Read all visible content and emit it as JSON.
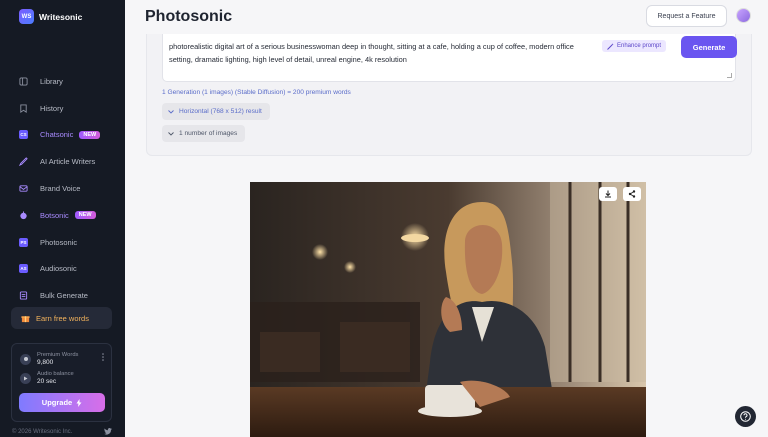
{
  "brand": {
    "name": "Writesonic",
    "logo_text": "WS"
  },
  "sidebar": {
    "items": [
      {
        "label": "Library",
        "icon": "library-icon"
      },
      {
        "label": "History",
        "icon": "bookmark-icon"
      },
      {
        "label": "Chatsonic",
        "icon": "chatsonic-icon",
        "badge": "NEW",
        "active": true
      },
      {
        "label": "AI Article Writers",
        "icon": "article-writer-icon"
      },
      {
        "label": "Brand Voice",
        "icon": "brand-voice-icon"
      },
      {
        "label": "Botsonic",
        "icon": "botsonic-icon",
        "badge": "NEW",
        "active": true
      },
      {
        "label": "Photosonic",
        "icon": "photosonic-icon"
      },
      {
        "label": "Audiosonic",
        "icon": "audiosonic-icon"
      },
      {
        "label": "Bulk Generate",
        "icon": "bulk-generate-icon"
      }
    ],
    "earn": "Earn free words",
    "usage": {
      "premium_label": "Premium Words",
      "premium_value": "9,800",
      "audio_label": "Audio balance",
      "audio_value": "20 sec",
      "upgrade_label": "Upgrade"
    },
    "copyright": "© 2026 Writesonic Inc."
  },
  "header": {
    "title": "Photosonic",
    "request_feature": "Request a Feature"
  },
  "prompt": {
    "text": "photorealistic digital art of a serious businesswoman deep in thought, sitting at a cafe, holding a cup of coffee, modern office setting, dramatic lighting, high level of detail, unreal engine, 4k resolution",
    "enhance_label": "Enhance prompt",
    "generate_label": "Generate",
    "info": "1 Generation (1 images) (Stable Diffusion) = 200 premium words",
    "orientation": "Horizontal (768 x 512) result",
    "image_count": "1 number of images"
  },
  "colors": {
    "accent": "#6a55f0",
    "sidebar_bg": "#151a24",
    "link": "#5a6cc9"
  }
}
